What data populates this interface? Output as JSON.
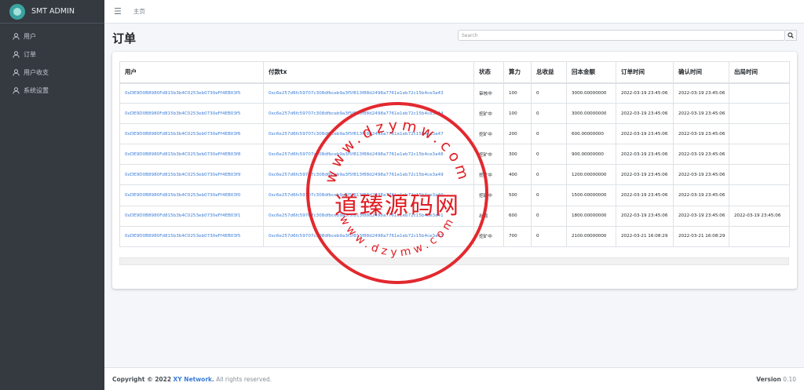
{
  "brand": {
    "name": "SMT ADMIN"
  },
  "sidebar": {
    "items": [
      {
        "label": "用户",
        "icon": "user-icon"
      },
      {
        "label": "订单",
        "icon": "user-icon"
      },
      {
        "label": "用户收支",
        "icon": "user-icon"
      },
      {
        "label": "系统设置",
        "icon": "user-icon"
      }
    ]
  },
  "topbar": {
    "home_link": "主页"
  },
  "page": {
    "title": "订单"
  },
  "search": {
    "placeholder": "Search"
  },
  "table": {
    "headers": [
      "用户",
      "付款tx",
      "状态",
      "算力",
      "总收益",
      "回本金额",
      "订单时间",
      "确认时间",
      "出局时间"
    ],
    "rows": [
      {
        "user": "0xDE9D0B8980Fd815b3b4C0253eb0730eFf4EB03f5",
        "tx": "0xc6e257d6fc59707c308dfbceb9a3f5f813f88d2498a7761e1eb72c15b4ce3a43",
        "status": "审核中",
        "power": "100",
        "total_income": "0",
        "payback": "3000.00000000",
        "order_time": "2022-03-19 23:45:06",
        "confirm_time": "2022-03-19 23:45:06",
        "exit_time": ""
      },
      {
        "user": "0xDE9D0B8980Fd815b3b4C0253eb0730eFf4EB03f5",
        "tx": "0xc6e257d6fc59707c308dfbceb9a3f5f813f88d2498a7761e1eb72c15b4ce3a44",
        "status": "挖矿中",
        "power": "100",
        "total_income": "0",
        "payback": "3000.00000000",
        "order_time": "2022-03-19 23:45:06",
        "confirm_time": "2022-03-19 23:45:06",
        "exit_time": ""
      },
      {
        "user": "0xDE9D0B8980Fd815b3b4C0253eb0730eFf4EB03f6",
        "tx": "0xc6e257d6fc59707c308dfbceb9a3f5f813f88d2498a7761e1eb72c15b4ce3a47",
        "status": "挖矿中",
        "power": "200",
        "total_income": "0",
        "payback": "600.00000000",
        "order_time": "2022-03-19 23:45:06",
        "confirm_time": "2022-03-19 23:45:06",
        "exit_time": ""
      },
      {
        "user": "0xDE9D0B8980Fd815b3b4C0253eb0730eFf4EB03f8",
        "tx": "0xc6e257d6fc59707c308dfbceb9a3f5f813f88d2498a7761e1eb72c15b4ce3a48",
        "status": "挖矿中",
        "power": "300",
        "total_income": "0",
        "payback": "900.00000000",
        "order_time": "2022-03-19 23:45:06",
        "confirm_time": "2022-03-19 23:45:06",
        "exit_time": ""
      },
      {
        "user": "0xDE9D0B8980Fd815b3b4C0253eb0730eFf4EB03f9",
        "tx": "0xc6e257d6fc59707c308dfbceb9a3f5f813f88d2498a7761e1eb72c15b4ce3a49",
        "status": "挖矿中",
        "power": "400",
        "total_income": "0",
        "payback": "1200.00000000",
        "order_time": "2022-03-19 23:45:06",
        "confirm_time": "2022-03-19 23:45:06",
        "exit_time": ""
      },
      {
        "user": "0xDE9D0B8980Fd815b3b4C0253eb0730eFf4EB03f0",
        "tx": "0xc6e257d6fc59707c308dfbceb9a3f5f813f88d2498a7761e1eb72c15b4ce3a40",
        "status": "挖矿中",
        "power": "500",
        "total_income": "0",
        "payback": "1500.00000000",
        "order_time": "2022-03-19 23:45:06",
        "confirm_time": "2022-03-19 23:45:06",
        "exit_time": ""
      },
      {
        "user": "0xDE9D0B8980Fd815b3b4C0253eb0730eFf4EB03f1",
        "tx": "0xc6e257d6fc59707c308dfbceb9a3f5f813f88d2498a7761e1eb72c15b4ce3a41",
        "status": "出局",
        "power": "600",
        "total_income": "0",
        "payback": "1800.00000000",
        "order_time": "2022-03-19 23:45:06",
        "confirm_time": "2022-03-19 23:45:06",
        "exit_time": "2022-03-19 23:45:06"
      },
      {
        "user": "0xDE9D0B8980Fd815b3b4C0253eb0730eFf4EB03f5",
        "tx": "0xc6e257d6fc59707c308dfbceb9a3f5f813f88d2498a7761e1eb72c15b4ce3a41",
        "status": "挖矿中",
        "power": "700",
        "total_income": "0",
        "payback": "2100.00000000",
        "order_time": "2022-03-21 16:08:29",
        "confirm_time": "2022-03-21 16:08:29",
        "exit_time": ""
      }
    ]
  },
  "footer": {
    "copyright": "Copyright © 2022",
    "company": "XY Network.",
    "rights": "All rights reserved.",
    "version_label": "Version",
    "version": "0.10"
  },
  "watermark": {
    "top_text": "www.dzymw.com",
    "bottom_text": "www.dzymw.com",
    "center_text": "道臻源码网",
    "color": "#e01e24"
  },
  "colors": {
    "sidebar_bg": "#343a40",
    "link": "#3b7dd8",
    "watermark": "#e01e24"
  }
}
